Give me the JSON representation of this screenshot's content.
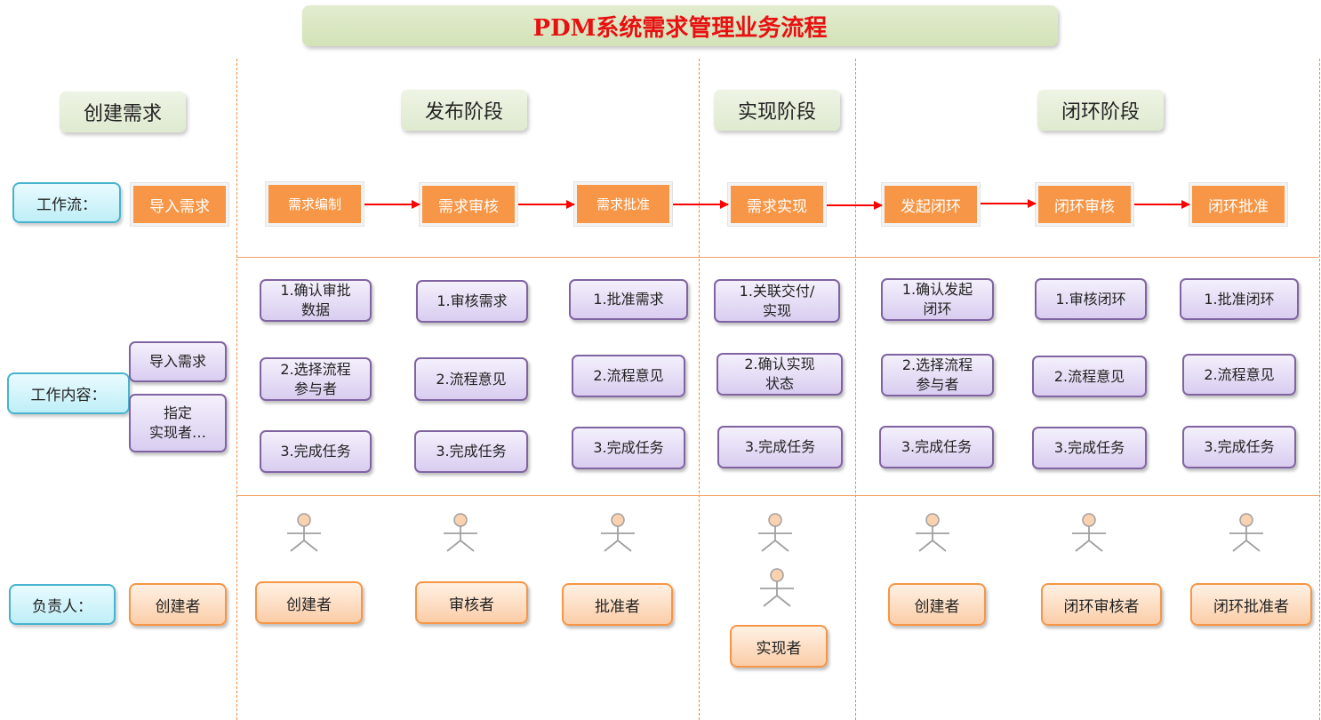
{
  "title": "PDM系统需求管理业务流程",
  "phases": {
    "create": "创建需求",
    "publish": "发布阶段",
    "implement": "实现阶段",
    "close": "闭环阶段"
  },
  "row_labels": {
    "workflow": "工作流：",
    "content": "工作内容：",
    "owner": "负责人："
  },
  "workflow": {
    "import": "导入需求",
    "edit": "需求编制",
    "review": "需求审核",
    "approve": "需求批准",
    "implement": "需求实现",
    "close_start": "发起闭环",
    "close_review": "闭环审核",
    "close_approve": "闭环批准"
  },
  "content": {
    "create": [
      "导入需求",
      "指定\n实现者…"
    ],
    "edit": [
      "1.确认审批\n数据",
      "2.选择流程\n参与者",
      "3.完成任务"
    ],
    "review": [
      "1.审核需求",
      "2.流程意见",
      "3.完成任务"
    ],
    "approve": [
      "1.批准需求",
      "2.流程意见",
      "3.完成任务"
    ],
    "implement": [
      "1.关联交付/\n实现",
      "2.确认实现\n状态",
      "3.完成任务"
    ],
    "close_start": [
      "1.确认发起\n闭环",
      "2.选择流程\n参与者",
      "3.完成任务"
    ],
    "close_review": [
      "1.审核闭环",
      "2.流程意见",
      "3.完成任务"
    ],
    "close_approve": [
      "1.批准闭环",
      "2.流程意见",
      "3.完成任务"
    ]
  },
  "owners": {
    "create": "创建者",
    "edit": "创建者",
    "review": "审核者",
    "approve": "批准者",
    "implement": "实现者",
    "close_start": "创建者",
    "close_review": "闭环审核者",
    "close_approve": "闭环批准者"
  },
  "colors": {
    "title": "#e81010",
    "workflow_box": "#f79646",
    "arrow": "#ff0000",
    "content_border": "#8064a2",
    "owner_border": "#f79646",
    "row_label_border": "#47b3cf",
    "divider": "#f28a3a"
  }
}
